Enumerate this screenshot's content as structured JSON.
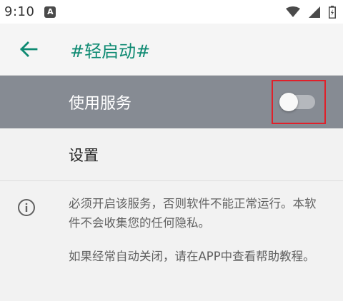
{
  "status_bar": {
    "time": "9:10",
    "notification_badge": "A",
    "icons": [
      "wifi-icon",
      "cellular-signal-icon",
      "battery-icon"
    ]
  },
  "app_bar": {
    "back_icon": "arrow-left-icon",
    "title": "#轻启动#"
  },
  "service_row": {
    "label": "使用服务",
    "switch_on": false
  },
  "settings_row": {
    "label": "设置"
  },
  "info": {
    "icon": "info-icon",
    "paragraph_1": "必须开启该服务，否则软件不能正常运行。本软件不会收集您的任何隐私。",
    "paragraph_2": " 如果经常自动关闭，请在APP中查看帮助教程。"
  },
  "colors": {
    "accent": "#0e8a72",
    "highlight_row": "#868b93",
    "annotation_box": "#e0202a"
  }
}
